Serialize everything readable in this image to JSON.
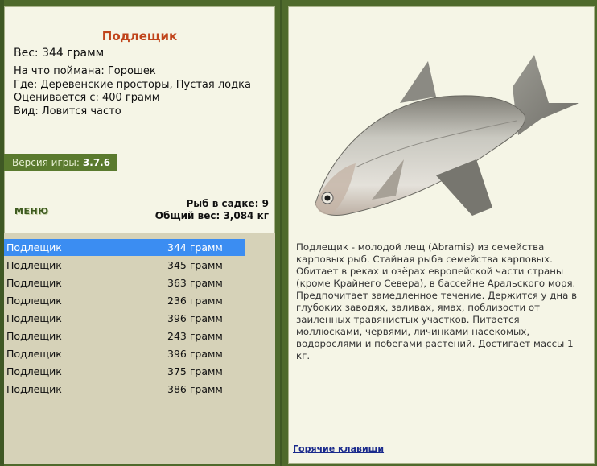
{
  "fish": {
    "title": "Подлещик",
    "weight": "Вес: 344 грамм",
    "bait": "На что поймана: Горошек",
    "location": "Где: Деревенские просторы, Пустая лодка",
    "value": "Оценивается с: 400 грамм",
    "kind": "Вид: Ловится часто"
  },
  "version": {
    "label": "Версия игры:",
    "value": "3.7.6"
  },
  "menu": {
    "label": "МЕНЮ"
  },
  "totals": {
    "count": "Рыб в садке: 9",
    "weight": "Общий вес: 3,084 кг"
  },
  "catch_list": [
    {
      "name": "Подлещик",
      "weight": "344 грамм",
      "selected": true
    },
    {
      "name": "Подлещик",
      "weight": "345 грамм",
      "selected": false
    },
    {
      "name": "Подлещик",
      "weight": "363 грамм",
      "selected": false
    },
    {
      "name": "Подлещик",
      "weight": "236 грамм",
      "selected": false
    },
    {
      "name": "Подлещик",
      "weight": "396 грамм",
      "selected": false
    },
    {
      "name": "Подлещик",
      "weight": "243 грамм",
      "selected": false
    },
    {
      "name": "Подлещик",
      "weight": "396 грамм",
      "selected": false
    },
    {
      "name": "Подлещик",
      "weight": "375 грамм",
      "selected": false
    },
    {
      "name": "Подлещик",
      "weight": "386 грамм",
      "selected": false
    }
  ],
  "description": "Подлещик - молодой лещ (Abramis) из семейства карповых рыб. Стайная рыба семейства карповых. Обитает в реках и озёрах европейской части страны (кроме Крайнего Севера), в бассейне Аральского моря. Предпочитает замедленное течение. Держится у дна в глубоких заводях, заливах, ямах, поблизости от заиленных травянистых участков. Питается моллюсками, червями, личинками насекомых, водорослями и побегами растений. Достигает массы 1 кг.",
  "hotkeys": "Горячие клавиши",
  "colors": {
    "frame": "#4f6a2c",
    "panel": "#f5f5e6",
    "title": "#c0441b",
    "selected_row": "#3b8df2",
    "list_bg": "#d6d2b8"
  }
}
